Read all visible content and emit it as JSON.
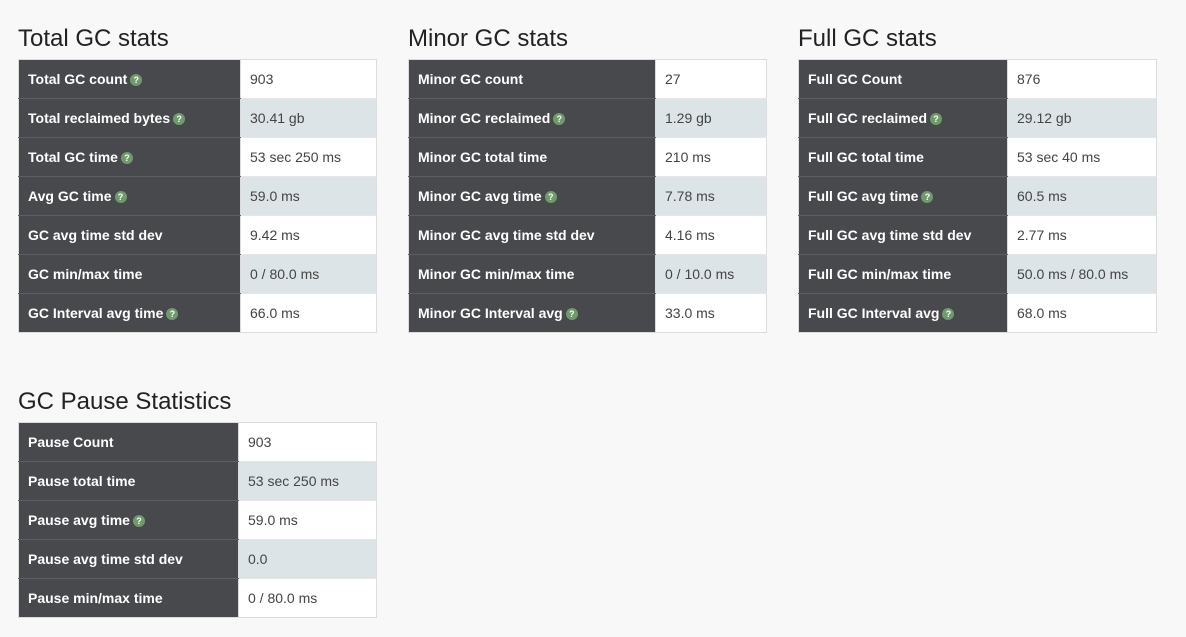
{
  "panels": [
    {
      "title": "Total GC stats",
      "rows": [
        {
          "label": "Total GC count",
          "value": "903",
          "help": true
        },
        {
          "label": "Total reclaimed bytes",
          "value": "30.41 gb",
          "help": true
        },
        {
          "label": "Total GC time",
          "value": "53 sec 250 ms",
          "help": true
        },
        {
          "label": "Avg GC time",
          "value": "59.0 ms",
          "help": true
        },
        {
          "label": "GC avg time std dev",
          "value": "9.42 ms",
          "help": false
        },
        {
          "label": "GC min/max time",
          "value": "0 / 80.0 ms",
          "help": false
        },
        {
          "label": "GC Interval avg time",
          "value": "66.0 ms",
          "help": true
        }
      ]
    },
    {
      "title": "Minor GC stats",
      "rows": [
        {
          "label": "Minor GC count",
          "value": "27",
          "help": false
        },
        {
          "label": "Minor GC reclaimed",
          "value": "1.29 gb",
          "help": true
        },
        {
          "label": "Minor GC total time",
          "value": "210 ms",
          "help": false
        },
        {
          "label": "Minor GC avg time",
          "value": "7.78 ms",
          "help": true
        },
        {
          "label": "Minor GC avg time std dev",
          "value": "4.16 ms",
          "help": false
        },
        {
          "label": "Minor GC min/max time",
          "value": "0 / 10.0 ms",
          "help": false
        },
        {
          "label": "Minor GC Interval avg",
          "value": "33.0 ms",
          "help": true
        }
      ]
    },
    {
      "title": "Full GC stats",
      "rows": [
        {
          "label": "Full GC Count",
          "value": "876",
          "help": false
        },
        {
          "label": "Full GC reclaimed",
          "value": "29.12 gb",
          "help": true
        },
        {
          "label": "Full GC total time",
          "value": "53 sec 40 ms",
          "help": false
        },
        {
          "label": "Full GC avg time",
          "value": "60.5 ms",
          "help": true
        },
        {
          "label": "Full GC avg time std dev",
          "value": "2.77 ms",
          "help": false
        },
        {
          "label": "Full GC min/max time",
          "value": "50.0 ms / 80.0 ms",
          "help": false
        },
        {
          "label": "Full GC Interval avg",
          "value": "68.0 ms",
          "help": true
        }
      ]
    },
    {
      "title": "GC Pause Statistics",
      "rows": [
        {
          "label": "Pause Count",
          "value": "903",
          "help": false
        },
        {
          "label": "Pause total time",
          "value": "53 sec 250 ms",
          "help": false
        },
        {
          "label": "Pause avg time",
          "value": "59.0 ms",
          "help": true
        },
        {
          "label": "Pause avg time std dev",
          "value": "0.0",
          "help": false
        },
        {
          "label": "Pause min/max time",
          "value": "0 / 80.0 ms",
          "help": false
        }
      ]
    }
  ],
  "help_icon": {
    "name": "help-icon",
    "glyph": "?",
    "color": "#6f9a6a"
  },
  "colors": {
    "label_bg": "#47494c",
    "alt_row_bg": "#dde4e8"
  }
}
